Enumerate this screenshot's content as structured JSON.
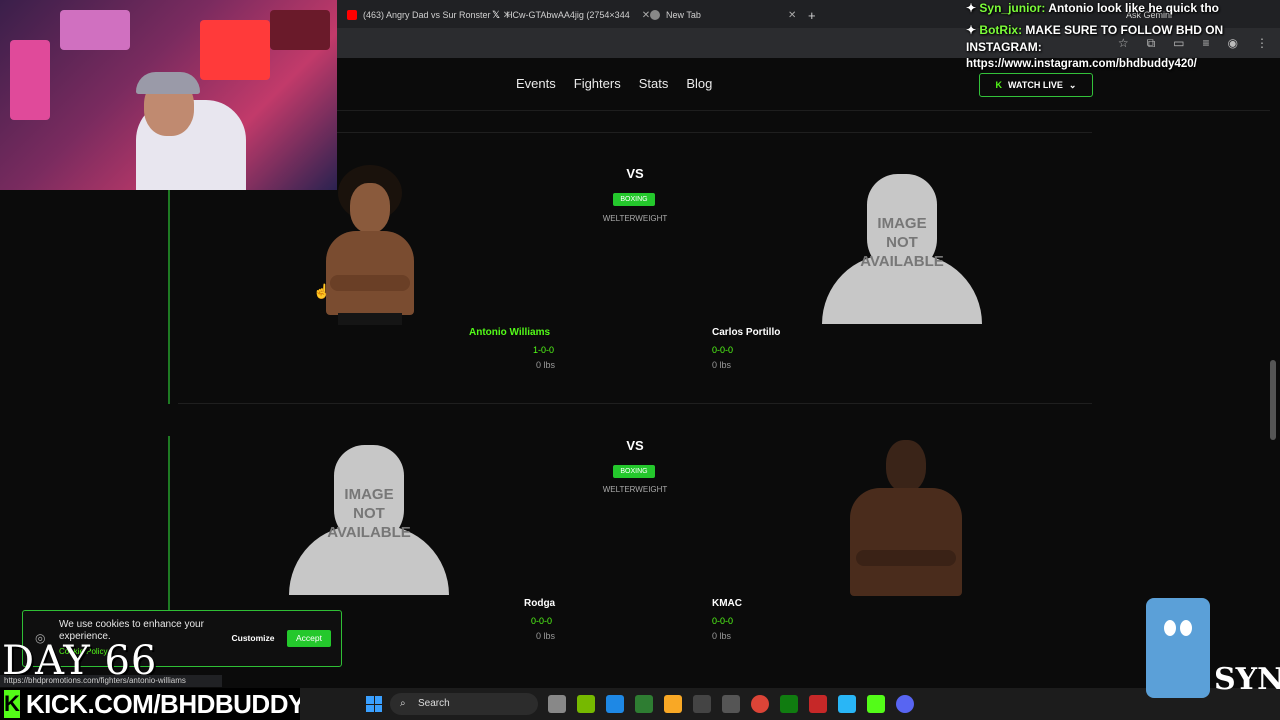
{
  "browser": {
    "tabs": [
      {
        "label": "(463) Angry Dad vs Sur Ronster",
        "favicon_color": "#ff0000"
      },
      {
        "label": "HCw-GTAbwAA4jig (2754×344",
        "favicon_color": "#111111"
      },
      {
        "label": "New Tab",
        "favicon_color": "#888888"
      }
    ],
    "new_tab_symbol": "+",
    "ask_gemini": "Ask Gemini",
    "status_url": "https://bhdpromotions.com/fighters/antonio-williams"
  },
  "nav": {
    "links": [
      "Events",
      "Fighters",
      "Stats",
      "Blog"
    ],
    "watch_live": "WATCH LIVE"
  },
  "fights": [
    {
      "vs": "VS",
      "sport": "BOXING",
      "weight_class": "WELTERWEIGHT",
      "left": {
        "name": "Antonio Williams",
        "record": "1-0-0",
        "weight": "0 lbs",
        "image": "photo"
      },
      "right": {
        "name": "Carlos Portillo",
        "record": "0-0-0",
        "weight": "0 lbs",
        "image": "placeholder"
      }
    },
    {
      "vs": "VS",
      "sport": "BOXING",
      "weight_class": "WELTERWEIGHT",
      "left": {
        "name": "Rodga",
        "record": "0-0-0",
        "weight": "0 lbs",
        "image": "placeholder"
      },
      "right": {
        "name": "KMAC",
        "record": "0-0-0",
        "weight": "0 lbs",
        "image": "photo"
      }
    }
  ],
  "placeholder_text": [
    "IMAGE",
    "NOT",
    "AVAILABLE"
  ],
  "chat": [
    {
      "user": "Syn_junior:",
      "message": "Antonio look like he quick tho"
    },
    {
      "user": "BotRix:",
      "message": "MAKE SURE TO FOLLOW BHD ON INSTAGRAM:"
    },
    {
      "user": "",
      "message": "https://www.instagram.com/bhdbuddy420/"
    }
  ],
  "cookie": {
    "message": "We use cookies to enhance your experience.",
    "policy": "Cookie Policy",
    "customize": "Customize",
    "accept": "Accept"
  },
  "overlay": {
    "day": "DAY 66",
    "kick_url": "KICK.COM/BHDBUDDY",
    "brand": "SYN"
  },
  "taskbar": {
    "search": "Search"
  },
  "colors": {
    "accent": "#53fc18",
    "badge": "#24c82c"
  }
}
